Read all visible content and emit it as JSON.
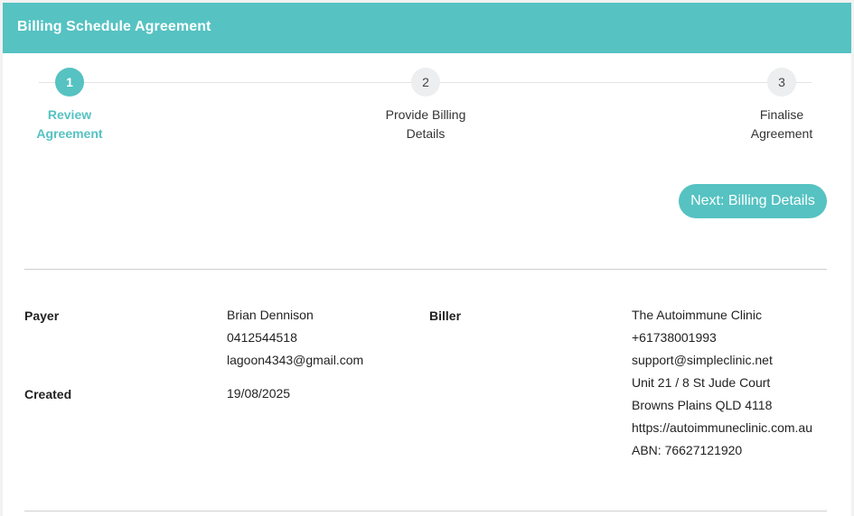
{
  "header": {
    "title": "Billing Schedule Agreement"
  },
  "stepper": {
    "steps": [
      {
        "number": "1",
        "label_line1": "Review",
        "label_line2": "Agreement",
        "state": "active"
      },
      {
        "number": "2",
        "label_line1": "Provide Billing",
        "label_line2": "Details",
        "state": "pending"
      },
      {
        "number": "3",
        "label_line1": "Finalise",
        "label_line2": "Agreement",
        "state": "pending"
      }
    ]
  },
  "actions": {
    "next_label": "Next: Billing Details"
  },
  "details": {
    "payer": {
      "label": "Payer",
      "name": "Brian Dennison",
      "phone": "0412544518",
      "email": "lagoon4343@gmail.com"
    },
    "created": {
      "label": "Created",
      "date": "19/08/2025"
    },
    "biller": {
      "label": "Biller",
      "name": "The Autoimmune Clinic",
      "phone": "+61738001993",
      "email": "support@simpleclinic.net",
      "address_line1": "Unit 21 / 8 St Jude Court",
      "address_line2": "Browns Plains QLD 4118",
      "website": "https://autoimmuneclinic.com.au",
      "abn": "ABN: 76627121920"
    }
  },
  "colors": {
    "accent": "#56c2c2",
    "pending_circle": "#eceeef",
    "divider": "#cfcfcf"
  }
}
